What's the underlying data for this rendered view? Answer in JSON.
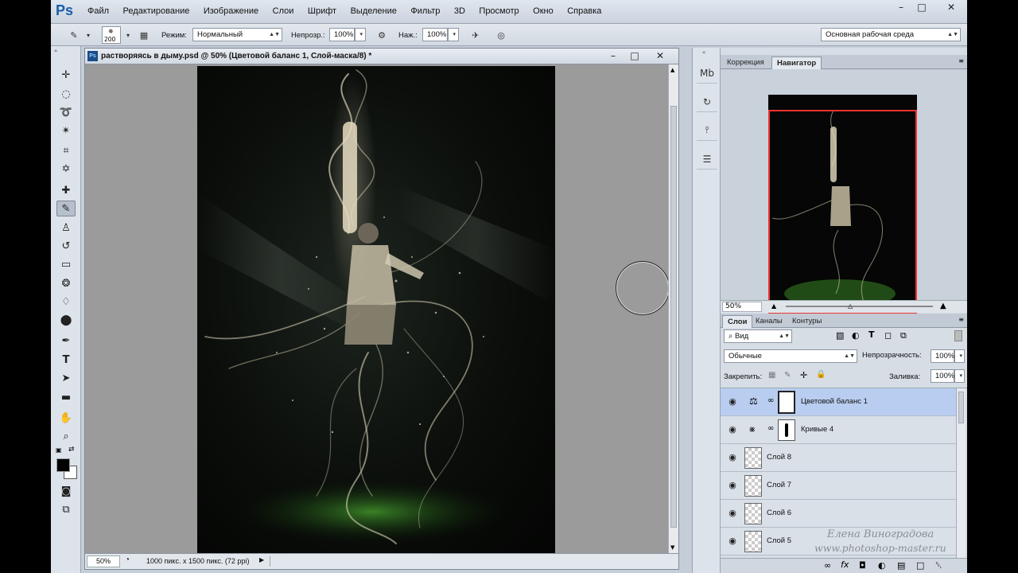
{
  "app": {
    "logo": "Ps"
  },
  "menu": [
    "Файл",
    "Редактирование",
    "Изображение",
    "Слои",
    "Шрифт",
    "Выделение",
    "Фильтр",
    "3D",
    "Просмотр",
    "Окно",
    "Справка"
  ],
  "options": {
    "brush_size": "200",
    "mode_label": "Режим:",
    "mode_value": "Нормальный",
    "opacity_label": "Непрозр.:",
    "opacity_value": "100%",
    "flow_label": "Наж.:",
    "flow_value": "100%",
    "workspace": "Основная рабочая среда"
  },
  "document": {
    "title": "растворяясь в дыму.psd @ 50% (Цветовой баланс 1, Слой-маска/8) *",
    "zoom": "50%",
    "info": "1000 пикс. x 1500 пикс. (72 ppi)"
  },
  "panels": {
    "top_tabs": [
      "Коррекция",
      "Навигатор"
    ],
    "nav_zoom": "50%",
    "layer_tabs": [
      "Слои",
      "Каналы",
      "Контуры"
    ],
    "filter_kind": "Вид",
    "blend_mode": "Обычные",
    "opacity_label": "Непрозрачность:",
    "opacity_value": "100%",
    "lock_label": "Закрепить:",
    "fill_label": "Заливка:",
    "fill_value": "100%"
  },
  "layers": [
    {
      "name": "Цветовой баланс 1",
      "type": "adjust-balance",
      "selected": true
    },
    {
      "name": "Кривые 4",
      "type": "adjust-curves",
      "selected": false
    },
    {
      "name": "Слой 8",
      "type": "pixel",
      "selected": false
    },
    {
      "name": "Слой 7",
      "type": "pixel",
      "selected": false
    },
    {
      "name": "Слой 6",
      "type": "pixel",
      "selected": false
    },
    {
      "name": "Слой 5",
      "type": "pixel",
      "selected": false
    }
  ],
  "watermark": {
    "author": "Елена Виноградова",
    "site": "www.photoshop-master.ru"
  }
}
